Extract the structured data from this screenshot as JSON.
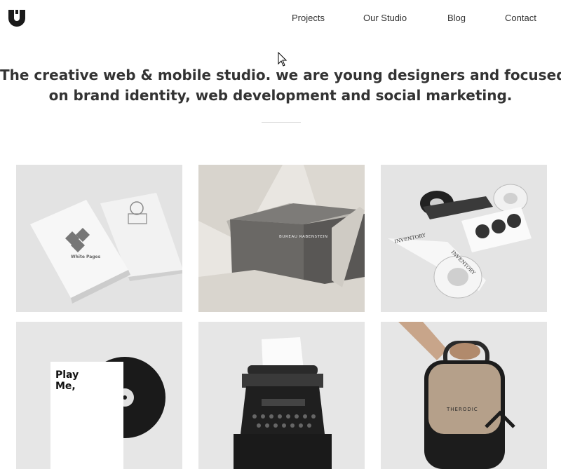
{
  "brand": {
    "logo_icon": "u-logo-icon",
    "logo_color": "#1a1a1a"
  },
  "nav": {
    "items": [
      {
        "label": "Projects"
      },
      {
        "label": "Our Studio"
      },
      {
        "label": "Blog"
      },
      {
        "label": "Contact"
      }
    ]
  },
  "hero": {
    "line1": "The creative web & mobile studio. we are young designers and focused",
    "line2": "on brand identity, web development and social marketing."
  },
  "projects": {
    "tiles": [
      {
        "name": "white-pages-cards",
        "icon": "business-cards-image",
        "card_text": "White Pages"
      },
      {
        "name": "bureau-box",
        "icon": "packaging-box-image",
        "box_text": "BUREAU RABENSTEIN"
      },
      {
        "name": "inventory-tape",
        "icon": "tape-rolls-image",
        "tape_text_1": "INVENTORY",
        "tape_text_2": "INVENTORY"
      },
      {
        "name": "play-me-record",
        "icon": "vinyl-record-image",
        "sleeve_line1": "Play",
        "sleeve_line2": "Me,"
      },
      {
        "name": "typewriter",
        "icon": "typewriter-image"
      },
      {
        "name": "therodic-bag",
        "icon": "carry-bag-image",
        "bag_text": "THERODIC"
      }
    ]
  },
  "colors": {
    "text": "#333333",
    "tile_bg": "#e6e6e6",
    "divider": "#dcdcdc"
  }
}
